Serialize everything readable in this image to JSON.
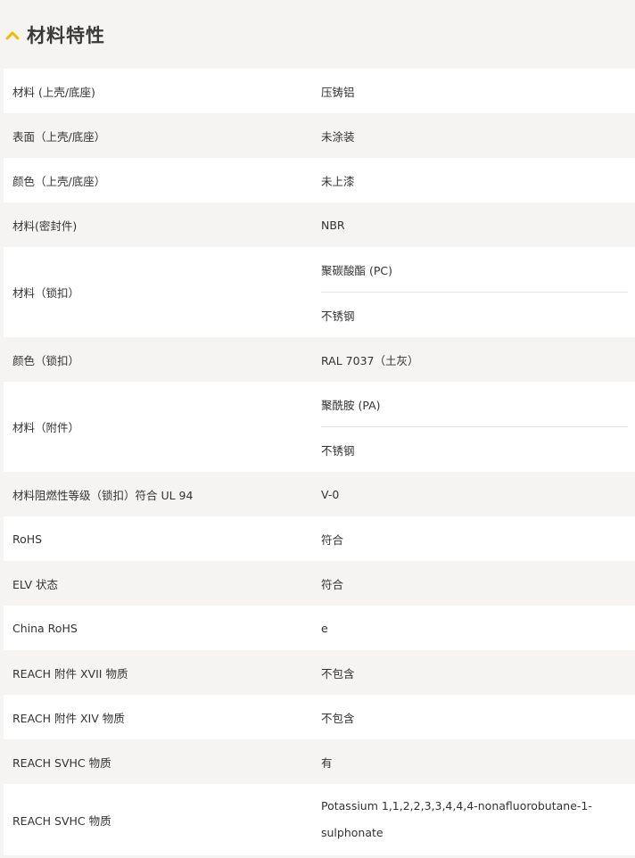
{
  "section": {
    "title": "材料特性",
    "icon": "chevron-up-icon",
    "accent_color": "#f5b800"
  },
  "rows": [
    {
      "label": "材料 (上壳/底座)",
      "values": [
        "压铸铝"
      ]
    },
    {
      "label": "表面（上壳/底座）",
      "values": [
        "未涂装"
      ]
    },
    {
      "label": "颜色（上壳/底座）",
      "values": [
        "未上漆"
      ]
    },
    {
      "label": "材料(密封件)",
      "values": [
        "NBR"
      ]
    },
    {
      "label": "材料（锁扣）",
      "values": [
        "聚碳酸酯 (PC)",
        "不锈钢"
      ]
    },
    {
      "label": "颜色（锁扣）",
      "values": [
        "RAL 7037（土灰）"
      ]
    },
    {
      "label": "材料（附件）",
      "values": [
        "聚酰胺 (PA)",
        "不锈钢"
      ]
    },
    {
      "label": "材料阻燃性等级（锁扣）符合 UL 94",
      "values": [
        "V-0"
      ]
    },
    {
      "label": "RoHS",
      "values": [
        "符合"
      ]
    },
    {
      "label": "ELV 状态",
      "values": [
        "符合"
      ]
    },
    {
      "label": "China RoHS",
      "values": [
        "e"
      ]
    },
    {
      "label": "REACH 附件 XVII 物质",
      "values": [
        "不包含"
      ]
    },
    {
      "label": "REACH 附件 XIV 物质",
      "values": [
        "不包含"
      ]
    },
    {
      "label": "REACH SVHC 物质",
      "values": [
        "有"
      ]
    },
    {
      "label": "REACH SVHC 物质",
      "values": [
        "Potassium 1,1,2,2,3,3,4,4,4-nonafluorobutane-1-sulphonate"
      ]
    }
  ]
}
